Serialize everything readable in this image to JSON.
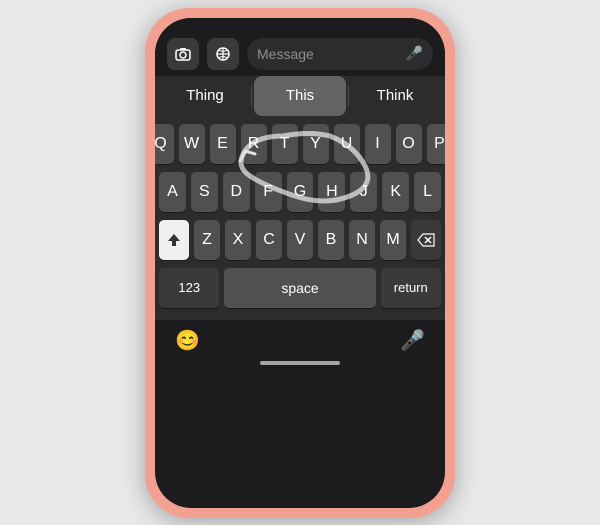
{
  "phone": {
    "message_placeholder": "Message",
    "autocomplete": {
      "left": "Thing",
      "center": "This",
      "right": "Think"
    },
    "keyboard": {
      "row1": [
        "Q",
        "W",
        "E",
        "R",
        "T",
        "Y",
        "U",
        "I",
        "O",
        "P"
      ],
      "row2": [
        "A",
        "S",
        "D",
        "F",
        "G",
        "H",
        "J",
        "K",
        "L"
      ],
      "row3": [
        "Z",
        "X",
        "C",
        "V",
        "B",
        "N",
        "M"
      ],
      "numbers_label": "123",
      "space_label": "space",
      "return_label": "return"
    },
    "bottom_bar": {
      "emoji_icon": "😊",
      "mic_icon": "🎤"
    }
  }
}
